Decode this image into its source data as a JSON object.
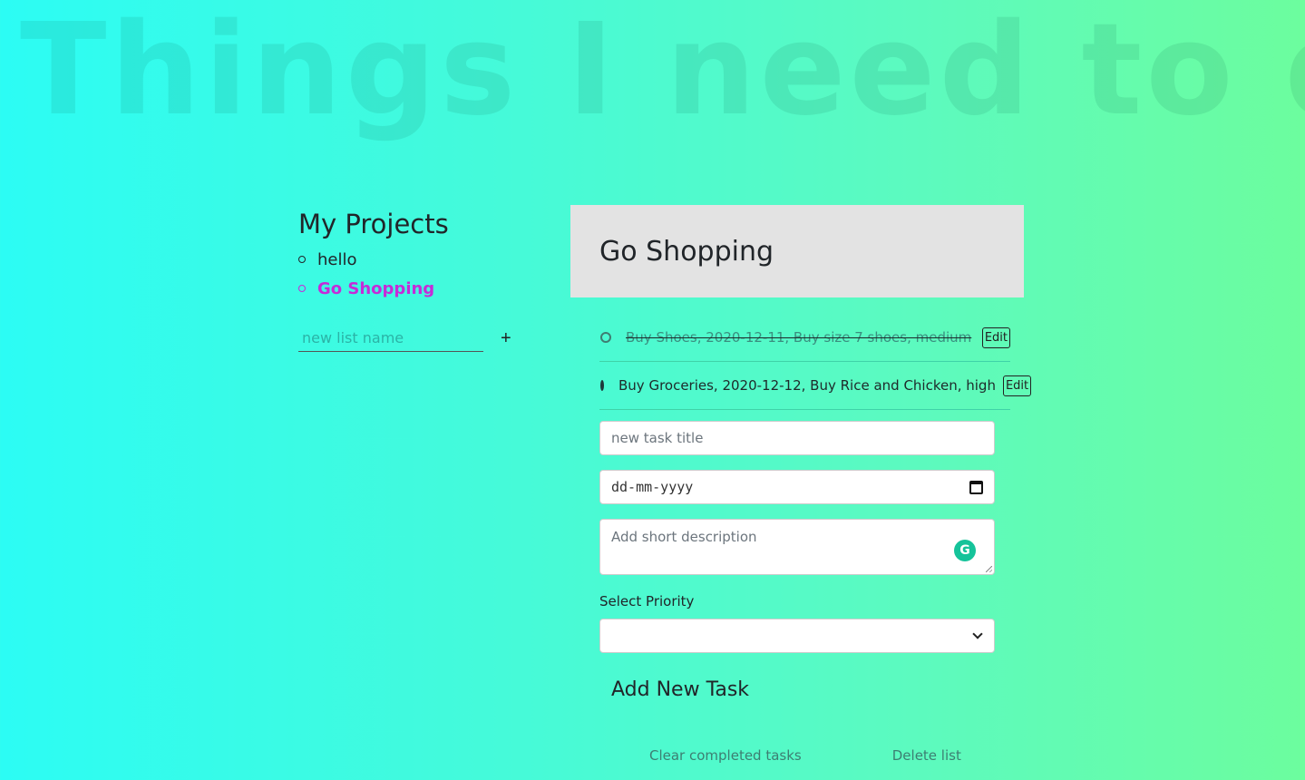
{
  "app": {
    "title": "Things I need to do"
  },
  "sidebar": {
    "heading": "My Projects",
    "projects": [
      {
        "label": "hello",
        "active": false
      },
      {
        "label": "Go Shopping",
        "active": true
      }
    ],
    "new_list_placeholder": "new list name",
    "add_label": "+"
  },
  "main": {
    "list_title": "Go Shopping",
    "tasks": [
      {
        "text": "Buy Shoes, 2020-12-11, Buy size 7 shoes, medium",
        "done": true,
        "edit_label": "Edit"
      },
      {
        "text": "Buy Groceries, 2020-12-12, Buy Rice and Chicken, high",
        "done": false,
        "edit_label": "Edit"
      }
    ],
    "form": {
      "title_placeholder": "new task title",
      "date_placeholder": "dd-mm-yyyy",
      "description_placeholder": "Add short description",
      "grammarly_glyph": "G",
      "priority_label": "Select Priority",
      "priority_value": "",
      "add_button_label": "Add New Task"
    },
    "actions": {
      "clear_label": "Clear completed tasks",
      "delete_label": "Delete list"
    }
  },
  "colors": {
    "active_project": "#c62bd8",
    "gradient_start": "#2cfcf4",
    "gradient_end": "#6cfd9e",
    "header_bg": "#e3e3e3",
    "grammarly": "#15c39a"
  },
  "icons": {
    "bullet": "circle-outline-icon",
    "calendar": "calendar-icon",
    "select": "chevron-down-icon",
    "grammarly": "grammarly-icon"
  }
}
